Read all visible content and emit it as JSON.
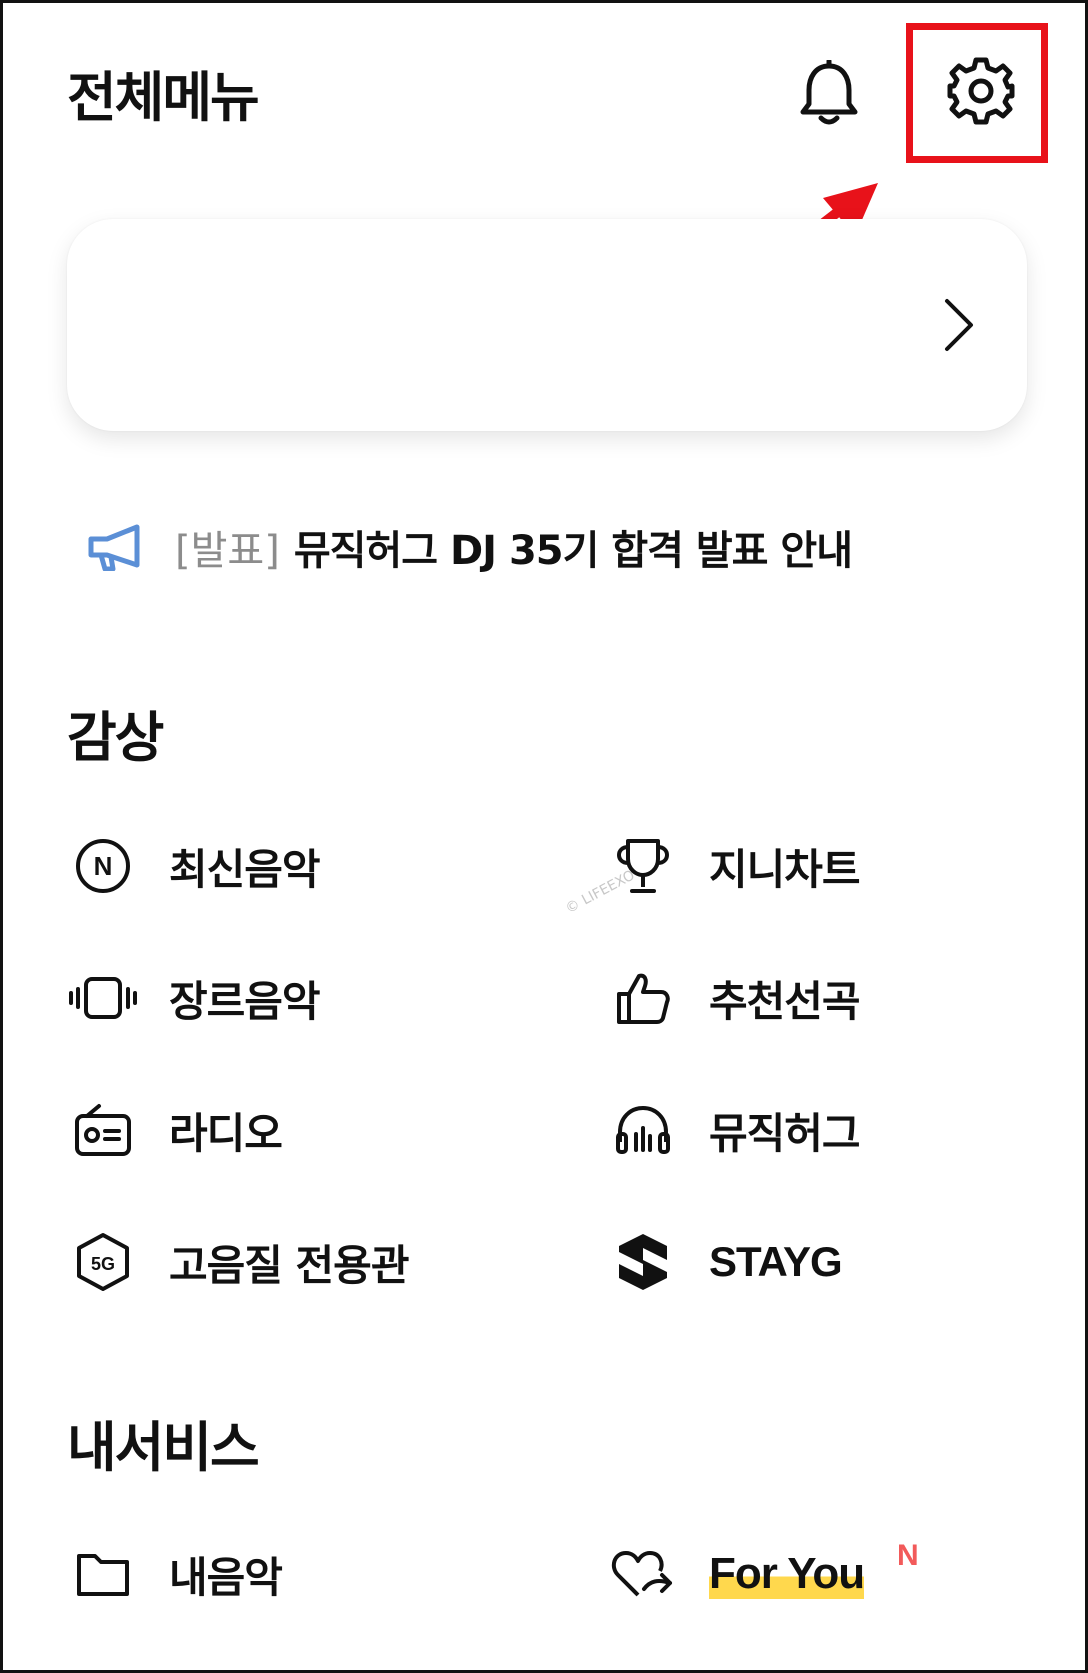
{
  "header": {
    "title": "전체메뉴"
  },
  "notice": {
    "tag": "[발표]",
    "text": "뮤직허그 DJ 35기 합격 발표 안내"
  },
  "sections": {
    "listening": {
      "title": "감상",
      "items": [
        {
          "label": "최신음악",
          "icon": "n-circle-icon"
        },
        {
          "label": "지니차트",
          "icon": "trophy-icon"
        },
        {
          "label": "장르음악",
          "icon": "vibration-icon"
        },
        {
          "label": "추천선곡",
          "icon": "thumbs-up-icon"
        },
        {
          "label": "라디오",
          "icon": "radio-icon"
        },
        {
          "label": "뮤직허그",
          "icon": "headphones-icon"
        },
        {
          "label": "고음질 전용관",
          "icon": "5g-hexagon-icon"
        },
        {
          "label": "STAYG",
          "icon": "stayg-logo-icon"
        }
      ]
    },
    "my_services": {
      "title": "내서비스",
      "items": [
        {
          "label": "내음악",
          "icon": "folder-icon"
        },
        {
          "label": "For You",
          "icon": "heart-arrow-icon",
          "badge": "N"
        }
      ]
    }
  },
  "watermark": "© LIFEEXO",
  "colors": {
    "highlight": "#e8121a",
    "megaphone": "#5b8fd6",
    "foryou_highlight": "#ffd84d",
    "new_badge": "#f25a5a"
  }
}
